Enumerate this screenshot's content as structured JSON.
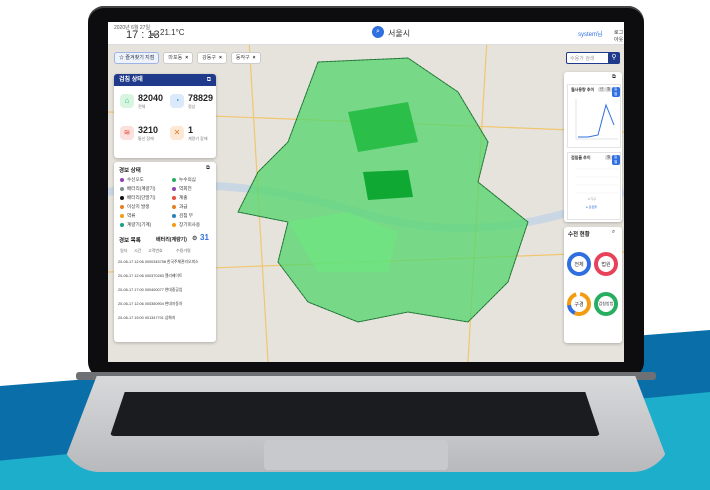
{
  "header": {
    "date": "2020년 6월 27일",
    "time": "17 : 13",
    "temperature": "21.1°C",
    "location": "서울시",
    "user": "system님",
    "logout": "로그아웃"
  },
  "favorites": {
    "label": "즐겨찾기 지점",
    "chips": [
      "마포동",
      "강동구",
      "동작구"
    ]
  },
  "search": {
    "placeholder": "수용가 검색"
  },
  "summary": {
    "title": "검침 상태",
    "stats": [
      {
        "value": "82040",
        "label": "전체",
        "color": "#2ecc71"
      },
      {
        "value": "78829",
        "label": "정상",
        "color": "#3498db"
      },
      {
        "value": "3210",
        "label": "통신 장애",
        "color": "#e74c3c"
      },
      {
        "value": "1",
        "label": "계량기 장애",
        "color": "#e67e22"
      }
    ]
  },
  "alarm": {
    "title": "경보 상태",
    "legend_left": [
      {
        "label": "수신오도",
        "color": "#8e44ad"
      },
      {
        "label": "배터리(계량기)",
        "color": "#7f8c8d"
      },
      {
        "label": "배터리(단말기)",
        "color": "#111111"
      },
      {
        "label": "이상치 발생",
        "color": "#e67e22"
      },
      {
        "label": "역류",
        "color": "#f39c12"
      },
      {
        "label": "계량기(기계)",
        "color": "#16a085"
      }
    ],
    "legend_right": [
      {
        "label": "누수의심",
        "color": "#27ae60"
      },
      {
        "label": "역회전",
        "color": "#8e44ad"
      },
      {
        "label": "계출",
        "color": "#e74c3c"
      },
      {
        "label": "과급",
        "color": "#e67e22"
      },
      {
        "label": "검침 무",
        "color": "#2980b9"
      },
      {
        "label": "장기미사용",
        "color": "#f39c12"
      }
    ]
  },
  "alarm_list": {
    "title": "경보 목록",
    "filter": "배터리(계량기)",
    "count": "31",
    "columns": [
      "일자",
      "시간",
      "고객번호",
      "수용가명"
    ],
    "rows": [
      {
        "date": "20-06-17",
        "time": "12:06",
        "id": "0000345758",
        "name": "한국주체관리오피스"
      },
      {
        "date": "20-06-17",
        "time": "12:06",
        "id": "000370283",
        "name": "엘리베이트"
      },
      {
        "date": "20-06-17",
        "time": "17:00",
        "id": "000400077",
        "name": "현대중공업"
      },
      {
        "date": "20-06-17",
        "time": "12:06",
        "id": "000350904",
        "name": "현대자동차"
      },
      {
        "date": "20-06-17",
        "time": "19:00",
        "id": "001347701",
        "name": "삼화지"
      }
    ]
  },
  "charts": {
    "usage": {
      "title": "월사용량 추이",
      "tags": [
        "년",
        "월",
        "일별"
      ]
    },
    "leak": {
      "title": "검침율 추이",
      "tags": [
        "월",
        "일별"
      ],
      "legend": "검침율",
      "note": "0 가구"
    }
  },
  "status": {
    "title": "수전 현황",
    "donuts": [
      {
        "label": "전체",
        "color": "#2f6fe0"
      },
      {
        "label": "법원",
        "color": "#e8425a"
      },
      {
        "label": "구경",
        "color": "#f39c12"
      },
      {
        "label": "검침방법",
        "color": "#27ae60"
      }
    ]
  }
}
